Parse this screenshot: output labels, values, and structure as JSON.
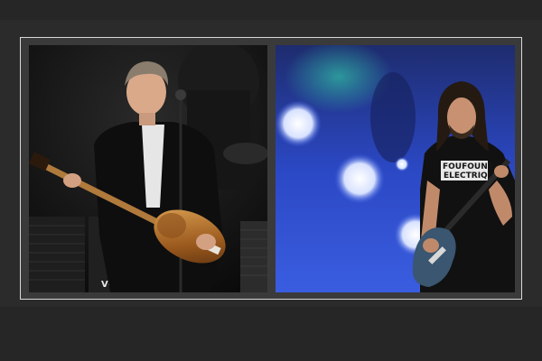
{
  "photos": [
    {
      "icon": "guitarist-with-violin-bass-photo",
      "amp_marks": [
        "VO",
        "VOX"
      ]
    },
    {
      "icon": "guitarist-with-electric-guitar-photo",
      "shirt_lines": [
        "FOUFOUNE",
        "ELECTRIQUE"
      ]
    }
  ]
}
